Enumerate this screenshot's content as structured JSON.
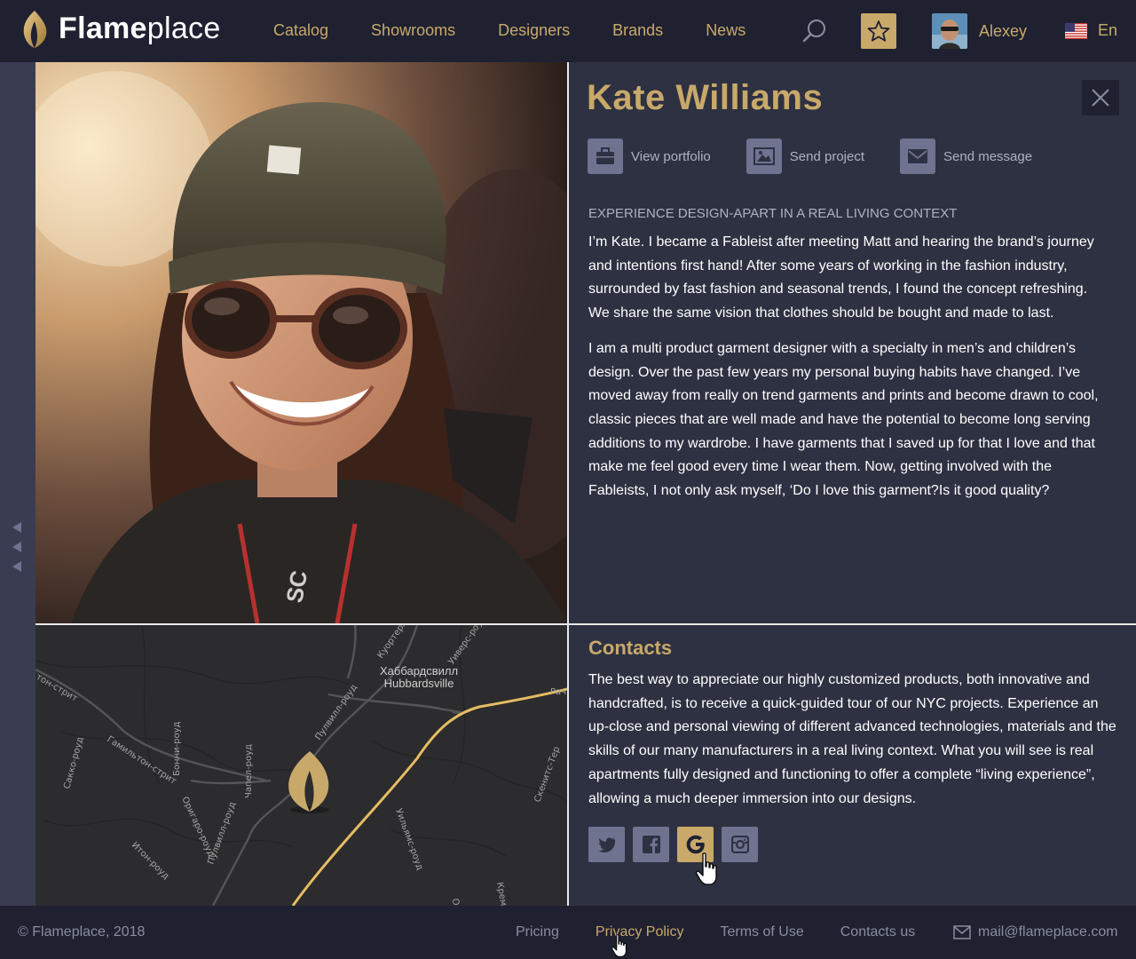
{
  "header": {
    "logo_bold": "Flame",
    "logo_light": "place",
    "nav": [
      "Catalog",
      "Showrooms",
      "Designers",
      "Brands",
      "News"
    ],
    "user_name": "Alexey",
    "lang": "En"
  },
  "profile": {
    "name": "Kate Williams",
    "actions": [
      {
        "label": "View portfolio",
        "icon": "briefcase-icon"
      },
      {
        "label": "Send project",
        "icon": "image-icon"
      },
      {
        "label": "Send message",
        "icon": "envelope-icon"
      }
    ],
    "headline": "EXPERIENCE DESIGN-APART IN A REAL LIVING CONTEXT",
    "bio": [
      "I’m Kate. I became a Fableist after meeting Matt and hearing the brand’s journey and intentions first hand! After some years of working in the fashion industry, surrounded by fast fashion and seasonal trends, I found the concept refreshing. We share the same vision that clothes should be bought and made to last.",
      "I am a multi product garment designer with a specialty in men’s and children’s design. Over the past few years my personal buying habits have changed. I’ve moved away from really on trend garments and prints and become drawn to cool, classic pieces that are well made and have the potential to become long serving additions to my wardrobe. I have garments that I saved up for that I love and that make me feel good every time I wear them. Now, getting involved with the Fableists, I not only ask myself, ‘Do I love this garment?Is it good quality?"
    ]
  },
  "map": {
    "town_ru": "Хаббардсвилл",
    "town_en": "Hubbardsville",
    "streets": [
      "тон-стрит",
      "Гамильтон-стрит",
      "Пулвилл-роуд",
      "Пулвилл-роуд",
      "Куортерли",
      "Уиверс-роуд",
      "Бонни-роуд",
      "Чапел-роуд",
      "Оригаро-роуд",
      "Сакко-роуд",
      "Итон-роуд",
      "Уильямс-роуд",
      "Скенитс-Тер",
      "Рачт",
      "Кремб",
      "Ол"
    ]
  },
  "contacts": {
    "title": "Contacts",
    "text": "The best way to appreciate our highly customized products, both innovative and handcrafted, is to receive a quick-guided tour of our NYC projects. Experience an up-close and personal viewing of different advanced technologies, materials and the skills of our many manufacturers in a real living context. What you will see is real apartments fully designed and functioning to offer a complete “living experience”, allowing a much deeper immersion into our designs.",
    "socials": [
      "twitter-icon",
      "facebook-icon",
      "google-icon",
      "instagram-icon"
    ],
    "active_social": "google-icon"
  },
  "footer": {
    "copyright": "© Flameplace, 2018",
    "links": [
      "Pricing",
      "Privacy Policy",
      "Terms of Use",
      "Contacts us"
    ],
    "active_link": "Privacy Policy",
    "email": "mail@flameplace.com"
  },
  "colors": {
    "gold": "#c8a96a",
    "header_bg": "#1f2131",
    "panel_bg": "#2e3142",
    "icon_bg": "#6f7390"
  }
}
